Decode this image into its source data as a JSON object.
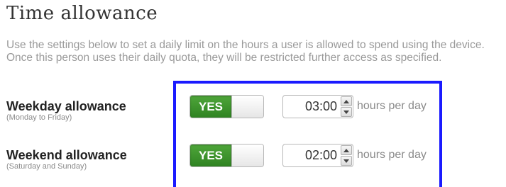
{
  "title": "Time allowance",
  "description": "Use the settings below to set a daily limit on the hours a user is allowed to spend using the device. Once this person uses their daily quota, they will be restricted further access as specified.",
  "weekday": {
    "label": "Weekday allowance",
    "sublabel": "(Monday to Friday)",
    "toggle": "YES",
    "hours": "03:00",
    "unit": "hours per day"
  },
  "weekend": {
    "label": "Weekend allowance",
    "sublabel": "(Saturday and Sunday)",
    "toggle": "YES",
    "hours": "02:00",
    "unit": "hours per day"
  },
  "colors": {
    "toggle_on": "#3c9a2c",
    "highlight_border": "#1a1aff"
  }
}
